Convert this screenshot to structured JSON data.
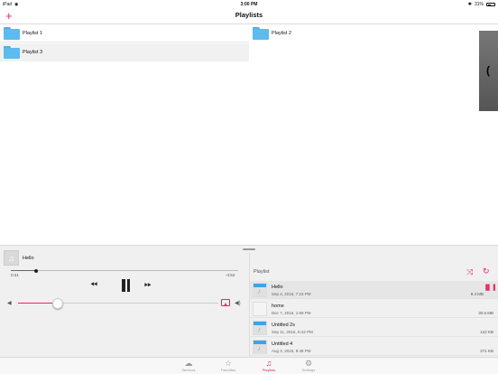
{
  "status": {
    "device": "iPad",
    "time": "3:00 PM",
    "battery": "31%"
  },
  "nav": {
    "add_icon": "plus-icon",
    "title": "Playlists"
  },
  "playlists": [
    {
      "label": "Playlist 1"
    },
    {
      "label": "Playlist 2"
    },
    {
      "label": "Playlist 3"
    }
  ],
  "side_handle": {
    "glyph": "("
  },
  "player": {
    "now_playing": "Hello",
    "elapsed": "0:31",
    "remaining": "-4:53",
    "progress": 0.11,
    "volume": 0.2
  },
  "playlist_panel": {
    "label": "Playlist",
    "tracks": [
      {
        "title": "Hello",
        "date": "Sep 4, 2016, 7:23 PM",
        "size": "9.4 MB"
      },
      {
        "title": "home",
        "date": "Dec 7, 2016, 1:59 PM",
        "size": "30.6 MB"
      },
      {
        "title": "Untitled 2s",
        "date": "Sep 11, 2016, 6:42 PM",
        "size": "122 KB"
      },
      {
        "title": "Untitled 4",
        "date": "Aug 3, 2016, 8:48 PM",
        "size": "271 KB"
      }
    ]
  },
  "tabs": [
    {
      "label": "Services",
      "icon": "cloud-icon"
    },
    {
      "label": "Favorites",
      "icon": "star-icon"
    },
    {
      "label": "Playlists",
      "icon": "playlist-icon"
    },
    {
      "label": "Settings",
      "icon": "gear-icon"
    }
  ],
  "colors": {
    "accent": "#e8265c",
    "folder": "#5cbbef"
  }
}
